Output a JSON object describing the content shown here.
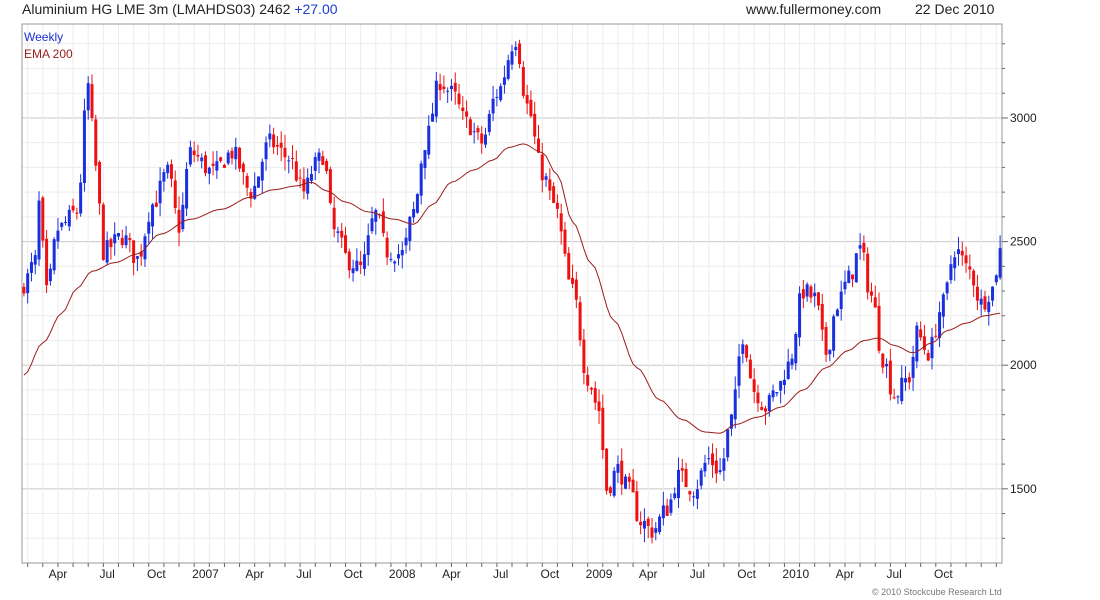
{
  "header": {
    "title": "Aluminium HG LME 3m (LMAHDS03) 2462",
    "change": "+27.00",
    "site": "www.fullermoney.com",
    "date": "22 Dec 2010"
  },
  "copyright": "© 2010 Stockcube Research Ltd",
  "colors": {
    "up": "#1a2fe0",
    "down": "#ee1111",
    "ema": "#9b1c1c",
    "grid": "#d9d9d9",
    "weekly_label": "#1a2fd1",
    "ema_label": "#9b1c1c"
  },
  "chart_data": {
    "type": "candlestick",
    "legend": {
      "placement": "top-left",
      "entries": [
        "Weekly",
        "EMA 200"
      ]
    },
    "y_axis": {
      "position": "right",
      "range": [
        1200,
        3380
      ],
      "ticks": [
        1500,
        2000,
        2500,
        3000
      ],
      "tick_labels": [
        "1500",
        "2000",
        "2500",
        "3000"
      ]
    },
    "x_axis": {
      "labels": [
        "Apr",
        "Jul",
        "Oct",
        "2007",
        "Apr",
        "Jul",
        "Oct",
        "2008",
        "Apr",
        "Jul",
        "Oct",
        "2009",
        "Apr",
        "Jul",
        "Oct",
        "2010",
        "Apr",
        "Jul",
        "Oct"
      ],
      "label_weeks": [
        9,
        22,
        35,
        48,
        61,
        74,
        87,
        100,
        113,
        126,
        139,
        152,
        165,
        178,
        191,
        204,
        217,
        230,
        243
      ]
    },
    "grid": true,
    "series": [
      {
        "name": "Weekly",
        "kind": "candlestick",
        "anchors": [
          [
            0,
            2330
          ],
          [
            3,
            2420
          ],
          [
            4,
            2650
          ],
          [
            6,
            2290
          ],
          [
            9,
            2550
          ],
          [
            14,
            2620
          ],
          [
            17,
            3130
          ],
          [
            19,
            2800
          ],
          [
            21,
            2460
          ],
          [
            26,
            2520
          ],
          [
            30,
            2430
          ],
          [
            34,
            2650
          ],
          [
            38,
            2780
          ],
          [
            41,
            2560
          ],
          [
            44,
            2860
          ],
          [
            50,
            2780
          ],
          [
            55,
            2860
          ],
          [
            60,
            2700
          ],
          [
            65,
            2900
          ],
          [
            70,
            2840
          ],
          [
            74,
            2700
          ],
          [
            77,
            2810
          ],
          [
            79,
            2850
          ],
          [
            82,
            2540
          ],
          [
            86,
            2420
          ],
          [
            89,
            2390
          ],
          [
            93,
            2610
          ],
          [
            96,
            2460
          ],
          [
            100,
            2450
          ],
          [
            103,
            2620
          ],
          [
            106,
            2900
          ],
          [
            110,
            3150
          ],
          [
            113,
            3100
          ],
          [
            117,
            2980
          ],
          [
            121,
            2900
          ],
          [
            125,
            3100
          ],
          [
            130,
            3320
          ],
          [
            133,
            3050
          ],
          [
            137,
            2780
          ],
          [
            140,
            2650
          ],
          [
            145,
            2300
          ],
          [
            149,
            1950
          ],
          [
            152,
            1820
          ],
          [
            154,
            1500
          ],
          [
            157,
            1580
          ],
          [
            160,
            1490
          ],
          [
            163,
            1370
          ],
          [
            166,
            1330
          ],
          [
            170,
            1420
          ],
          [
            173,
            1550
          ],
          [
            177,
            1500
          ],
          [
            181,
            1620
          ],
          [
            184,
            1570
          ],
          [
            187,
            1780
          ],
          [
            190,
            2120
          ],
          [
            193,
            1900
          ],
          [
            196,
            1830
          ],
          [
            199,
            1900
          ],
          [
            202,
            2000
          ],
          [
            206,
            2300
          ],
          [
            209,
            2270
          ],
          [
            212,
            2050
          ],
          [
            215,
            2250
          ],
          [
            218,
            2350
          ],
          [
            221,
            2470
          ],
          [
            224,
            2280
          ],
          [
            227,
            2030
          ],
          [
            230,
            1880
          ],
          [
            234,
            1950
          ],
          [
            236,
            2130
          ],
          [
            239,
            2050
          ],
          [
            243,
            2250
          ],
          [
            246,
            2470
          ],
          [
            250,
            2380
          ],
          [
            253,
            2250
          ],
          [
            256,
            2310
          ],
          [
            258,
            2462
          ]
        ]
      },
      {
        "name": "EMA 200",
        "kind": "line",
        "anchors": [
          [
            0,
            1960
          ],
          [
            5,
            2090
          ],
          [
            10,
            2210
          ],
          [
            14,
            2310
          ],
          [
            18,
            2380
          ],
          [
            24,
            2415
          ],
          [
            30,
            2450
          ],
          [
            36,
            2530
          ],
          [
            44,
            2590
          ],
          [
            52,
            2630
          ],
          [
            60,
            2680
          ],
          [
            66,
            2710
          ],
          [
            72,
            2725
          ],
          [
            76,
            2740
          ],
          [
            80,
            2705
          ],
          [
            85,
            2660
          ],
          [
            91,
            2620
          ],
          [
            98,
            2590
          ],
          [
            103,
            2570
          ],
          [
            108,
            2650
          ],
          [
            113,
            2740
          ],
          [
            119,
            2790
          ],
          [
            124,
            2830
          ],
          [
            128,
            2880
          ],
          [
            132,
            2895
          ],
          [
            137,
            2860
          ],
          [
            141,
            2770
          ],
          [
            145,
            2580
          ],
          [
            150,
            2410
          ],
          [
            156,
            2180
          ],
          [
            162,
            1990
          ],
          [
            168,
            1860
          ],
          [
            174,
            1780
          ],
          [
            180,
            1730
          ],
          [
            184,
            1725
          ],
          [
            188,
            1760
          ],
          [
            194,
            1790
          ],
          [
            200,
            1830
          ],
          [
            206,
            1900
          ],
          [
            212,
            1990
          ],
          [
            218,
            2060
          ],
          [
            222,
            2100
          ],
          [
            226,
            2110
          ],
          [
            230,
            2080
          ],
          [
            235,
            2050
          ],
          [
            240,
            2090
          ],
          [
            244,
            2140
          ],
          [
            249,
            2170
          ],
          [
            254,
            2200
          ],
          [
            258,
            2210
          ]
        ]
      }
    ]
  }
}
